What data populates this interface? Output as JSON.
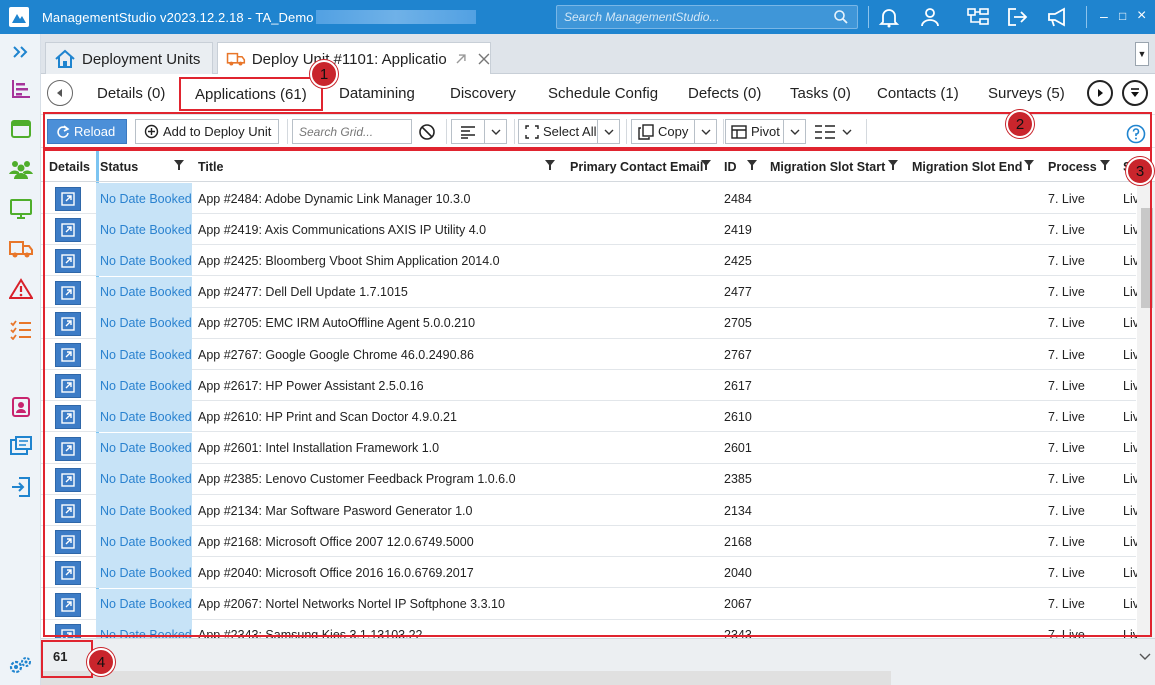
{
  "app": {
    "title": "ManagementStudio v2023.12.2.18 - TA_Demo",
    "search_placeholder": "Search ManagementStudio...",
    "window_controls": [
      "–",
      "□",
      "×"
    ]
  },
  "doc_tabs": [
    {
      "label": "Deployment Units",
      "icon": "home-icon"
    },
    {
      "label": "Deploy Unit #1101: Applicatio...",
      "icon": "truck-icon"
    }
  ],
  "sub_tabs": [
    {
      "label": "Details (0)"
    },
    {
      "label": "Applications (61)",
      "active": true
    },
    {
      "label": "Datamining"
    },
    {
      "label": "Discovery"
    },
    {
      "label": "Schedule Config"
    },
    {
      "label": "Defects (0)"
    },
    {
      "label": "Tasks (0)"
    },
    {
      "label": "Contacts (1)"
    },
    {
      "label": "Surveys (5)"
    }
  ],
  "toolbar": {
    "reload": "Reload",
    "add_to_deploy_unit": "Add to Deploy Unit",
    "search_placeholder": "Search Grid...",
    "select_all": "Select All",
    "copy": "Copy",
    "pivot": "Pivot"
  },
  "grid": {
    "columns": [
      "Details",
      "Status",
      "Title",
      "Primary Contact Email",
      "ID",
      "Migration Slot Start",
      "Migration Slot End",
      "Process",
      "S"
    ],
    "rows": [
      {
        "status": "No Date Booked",
        "title": "App #2484: Adobe Dynamic Link Manager 10.3.0",
        "id": "2484",
        "process": "7. Live",
        "s": "Liv"
      },
      {
        "status": "No Date Booked",
        "title": "App #2419: Axis Communications AXIS IP Utility 4.0",
        "id": "2419",
        "process": "7. Live",
        "s": "Liv"
      },
      {
        "status": "No Date Booked",
        "title": "App #2425: Bloomberg Vboot Shim Application 2014.0",
        "id": "2425",
        "process": "7. Live",
        "s": "Liv"
      },
      {
        "status": "No Date Booked",
        "title": "App #2477: Dell Dell Update 1.7.1015",
        "id": "2477",
        "process": "7. Live",
        "s": "Liv"
      },
      {
        "status": "No Date Booked",
        "title": "App #2705: EMC IRM AutoOffline Agent 5.0.0.210",
        "id": "2705",
        "process": "7. Live",
        "s": "Liv"
      },
      {
        "status": "No Date Booked",
        "title": "App #2767: Google Google Chrome 46.0.2490.86",
        "id": "2767",
        "process": "7. Live",
        "s": "Liv"
      },
      {
        "status": "No Date Booked",
        "title": "App #2617: HP Power Assistant 2.5.0.16",
        "id": "2617",
        "process": "7. Live",
        "s": "Liv"
      },
      {
        "status": "No Date Booked",
        "title": "App #2610: HP Print and Scan Doctor 4.9.0.21",
        "id": "2610",
        "process": "7. Live",
        "s": "Liv"
      },
      {
        "status": "No Date Booked",
        "title": "App #2601: Intel Installation Framework 1.0",
        "id": "2601",
        "process": "7. Live",
        "s": "Liv"
      },
      {
        "status": "No Date Booked",
        "title": "App #2385: Lenovo Customer Feedback Program 1.0.6.0",
        "id": "2385",
        "process": "7. Live",
        "s": "Liv"
      },
      {
        "status": "No Date Booked",
        "title": "App #2134: Mar Software Pasword Generator 1.0",
        "id": "2134",
        "process": "7. Live",
        "s": "Liv"
      },
      {
        "status": "No Date Booked",
        "title": "App #2168: Microsoft Office 2007 12.0.6749.5000",
        "id": "2168",
        "process": "7. Live",
        "s": "Liv"
      },
      {
        "status": "No Date Booked",
        "title": "App #2040: Microsoft Office 2016 16.0.6769.2017",
        "id": "2040",
        "process": "7. Live",
        "s": "Liv"
      },
      {
        "status": "No Date Booked",
        "title": "App #2067: Nortel Networks Nortel IP Softphone 3.3.10",
        "id": "2067",
        "process": "7. Live",
        "s": "Liv"
      },
      {
        "status": "No Date Booked",
        "title": "App #2343: Samsung Kies 3.1.13103.22",
        "id": "2343",
        "process": "7. Live",
        "s": "Liv"
      }
    ]
  },
  "footer": {
    "row_count": "61"
  },
  "annotations": [
    "1",
    "2",
    "3",
    "4"
  ],
  "colors": {
    "titlebar": "#1f84cf",
    "accent": "#4b8fd8",
    "status_bg": "#c7e3f7",
    "status_text": "#2a82cf",
    "annotation": "#e0242f"
  }
}
